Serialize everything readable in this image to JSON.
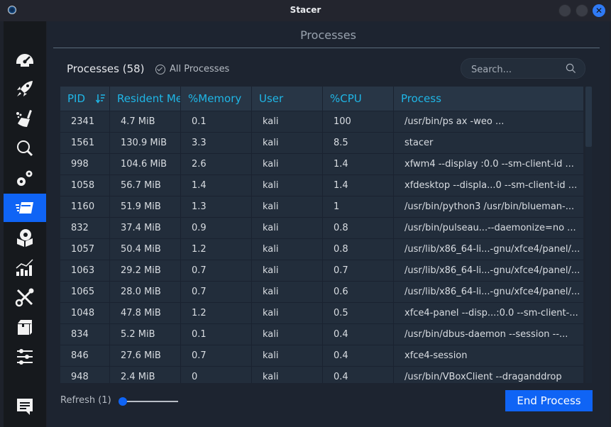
{
  "window": {
    "title": "Stacer"
  },
  "sidebar": {
    "items": [
      {
        "name": "dashboard",
        "icon": "speedometer-icon",
        "active": false
      },
      {
        "name": "startup-apps",
        "icon": "rocket-icon",
        "active": false
      },
      {
        "name": "system-cleaner",
        "icon": "broom-icon",
        "active": false
      },
      {
        "name": "search",
        "icon": "magnifier-icon",
        "active": false
      },
      {
        "name": "services",
        "icon": "gears-icon",
        "active": false
      },
      {
        "name": "processes",
        "icon": "processes-icon",
        "active": true
      },
      {
        "name": "uninstaller",
        "icon": "package-disk-icon",
        "active": false
      },
      {
        "name": "resources",
        "icon": "chart-icon",
        "active": false
      },
      {
        "name": "helpers",
        "icon": "tools-icon",
        "active": false
      },
      {
        "name": "apt-repository",
        "icon": "box-icon",
        "active": false
      },
      {
        "name": "settings",
        "icon": "sliders-icon",
        "active": false
      },
      {
        "name": "feedback",
        "icon": "feedback-icon",
        "active": false
      }
    ]
  },
  "page": {
    "title": "Processes"
  },
  "toolbar": {
    "count_label": "Processes (58)",
    "all_processes_label": "All Processes",
    "search_placeholder": "Search...",
    "search_value": ""
  },
  "table": {
    "columns": [
      "PID",
      "Resident Memory",
      "%Memory",
      "User",
      "%CPU",
      "Process"
    ],
    "sort_column": "PID",
    "rows": [
      [
        "2341",
        "4.7 MiB",
        "0.1",
        "kali",
        "100",
        "/usr/bin/ps ax -weo ..."
      ],
      [
        "1561",
        "130.9 MiB",
        "3.3",
        "kali",
        "8.5",
        "stacer"
      ],
      [
        "998",
        "104.6 MiB",
        "2.6",
        "kali",
        "1.4",
        "xfwm4 --display :0.0 --sm-client-id ..."
      ],
      [
        "1058",
        "56.7 MiB",
        "1.4",
        "kali",
        "1.4",
        "xfdesktop --displa...0 --sm-client-id ..."
      ],
      [
        "1160",
        "51.9 MiB",
        "1.3",
        "kali",
        "1",
        "/usr/bin/python3 /usr/bin/blueman-..."
      ],
      [
        "832",
        "37.4 MiB",
        "0.9",
        "kali",
        "0.8",
        "/usr/bin/pulseau...--daemonize=no ..."
      ],
      [
        "1057",
        "50.4 MiB",
        "1.2",
        "kali",
        "0.8",
        "/usr/lib/x86_64-li...-gnu/xfce4/panel/..."
      ],
      [
        "1063",
        "29.2 MiB",
        "0.7",
        "kali",
        "0.7",
        "/usr/lib/x86_64-li...-gnu/xfce4/panel/..."
      ],
      [
        "1065",
        "28.0 MiB",
        "0.7",
        "kali",
        "0.6",
        "/usr/lib/x86_64-li...-gnu/xfce4/panel/..."
      ],
      [
        "1048",
        "47.8 MiB",
        "1.2",
        "kali",
        "0.5",
        "xfce4-panel --disp...:0.0 --sm-client-..."
      ],
      [
        "834",
        "5.2 MiB",
        "0.1",
        "kali",
        "0.4",
        "/usr/bin/dbus-daemon --session --..."
      ],
      [
        "846",
        "27.6 MiB",
        "0.7",
        "kali",
        "0.4",
        "xfce4-session"
      ],
      [
        "948",
        "2.4 MiB",
        "0",
        "kali",
        "0.4",
        "/usr/bin/VBoxClient --draganddrop"
      ]
    ]
  },
  "footer": {
    "refresh_label": "Refresh (1)",
    "refresh_value": 1,
    "end_process_label": "End Process"
  },
  "colors": {
    "accent": "#0f64f5",
    "header_text": "#1fb6e6"
  }
}
